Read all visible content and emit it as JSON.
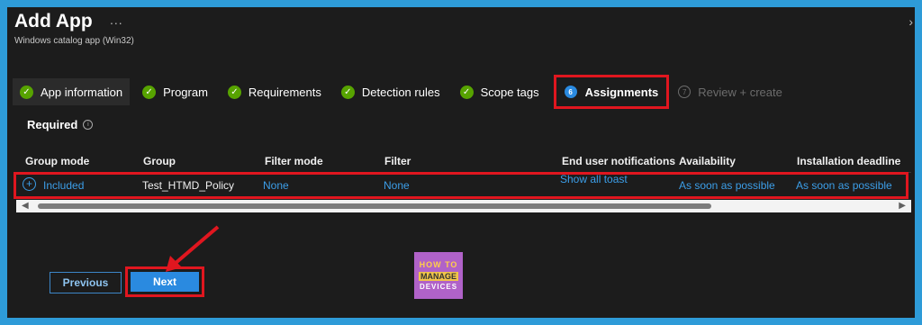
{
  "header": {
    "title": "Add App",
    "more": "...",
    "subtitle": "Windows catalog app (Win32)",
    "collapse": "›"
  },
  "steps": [
    {
      "label": "App information",
      "state": "complete"
    },
    {
      "label": "Program",
      "state": "complete"
    },
    {
      "label": "Requirements",
      "state": "complete"
    },
    {
      "label": "Detection rules",
      "state": "complete"
    },
    {
      "label": "Scope tags",
      "state": "complete"
    },
    {
      "label": "Assignments",
      "state": "current",
      "badge": "6"
    },
    {
      "label": "Review + create",
      "state": "upcoming",
      "badge": "7"
    }
  ],
  "section": {
    "label": "Required",
    "info": "i"
  },
  "table": {
    "columns": [
      "Group mode",
      "Group",
      "Filter mode",
      "Filter",
      "End user notifications",
      "Availability",
      "Installation deadline"
    ],
    "rows": [
      {
        "group_mode": "Included",
        "group": "Test_HTMD_Policy",
        "filter_mode": "None",
        "filter": "None",
        "notifications": "Show all toast",
        "notifications_overflow": "notifications",
        "availability": "As soon as possible",
        "deadline": "As soon as possible"
      }
    ]
  },
  "scrollbar": {
    "left": "◀",
    "right": "▶"
  },
  "buttons": {
    "previous": "Previous",
    "next": "Next"
  },
  "logo": {
    "line1": "HOW TO",
    "line2": "MANAGE",
    "line3": "DEVICES"
  },
  "colors": {
    "accent": "#2a8ae0",
    "highlight": "#e0161f",
    "success": "#57a300",
    "link": "#3c9ee8"
  }
}
